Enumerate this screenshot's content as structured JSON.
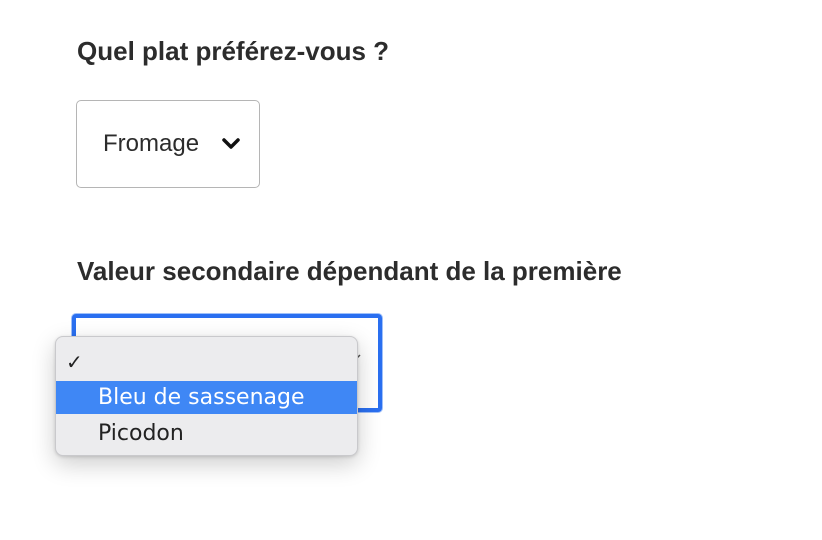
{
  "question1": {
    "label": "Quel plat préférez-vous ?",
    "select_value": "Fromage",
    "icon": "chevron-down-icon"
  },
  "question2": {
    "label": "Valeur secondaire dépendant de la première",
    "select_value": "",
    "dropdown": {
      "options": [
        {
          "label": "",
          "checked": true,
          "highlighted": false
        },
        {
          "label": "Bleu de sassenage",
          "checked": false,
          "highlighted": true
        },
        {
          "label": "Picodon",
          "checked": false,
          "highlighted": false
        }
      ],
      "check_glyph": "✓",
      "highlight_color": "#3f87f5"
    },
    "focus_color": "#2a6ff0"
  }
}
